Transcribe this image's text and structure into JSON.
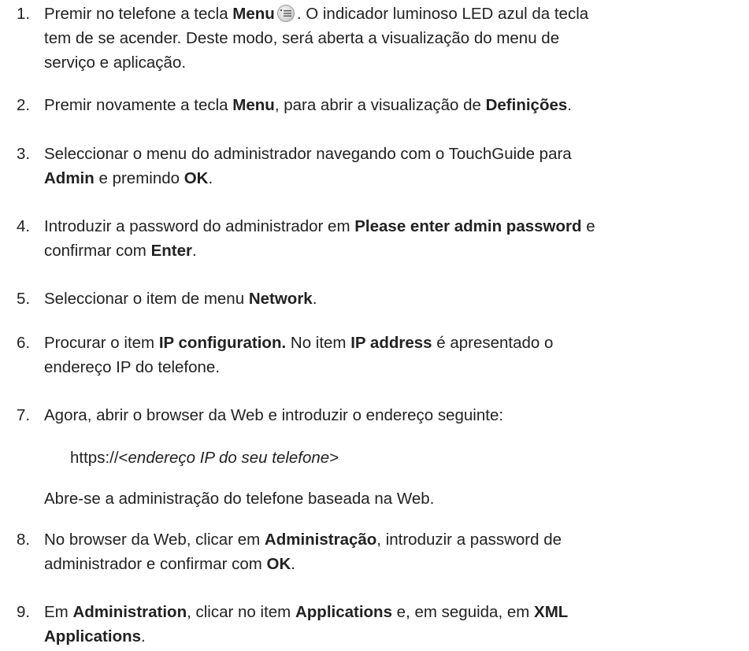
{
  "steps": [
    {
      "number": "1.",
      "lines": [
        {
          "t1": "Premir no telefone a tecla ",
          "b1": "Menu",
          "t2": ". O indicador luminoso LED azul da tecla"
        },
        {
          "t1": "tem de se acender. Deste modo, será aberta a visualização do menu de"
        },
        {
          "t1": "serviço e aplicação."
        }
      ]
    },
    {
      "number": "2.",
      "lines": [
        {
          "t1": "Premir novamente a tecla ",
          "b1": "Menu",
          "t2": ", para abrir a visualização de ",
          "b2": "Definições",
          "t3": "."
        }
      ]
    },
    {
      "number": "3.",
      "lines": [
        {
          "t1": "Seleccionar o menu do administrador navegando com o TouchGuide para"
        },
        {
          "b1": "Admin",
          "t2": " e premindo ",
          "b2": "OK",
          "t3": "."
        }
      ]
    },
    {
      "number": "4.",
      "lines": [
        {
          "t1": "Introduzir a password do administrador em ",
          "b1": "Please enter admin password",
          "t2": " e"
        },
        {
          "t1": "confirmar com ",
          "b1": "Enter",
          "t2": "."
        }
      ]
    },
    {
      "number": "5.",
      "lines": [
        {
          "t1": "Seleccionar o item de menu ",
          "b1": "Network",
          "t2": "."
        }
      ]
    },
    {
      "number": "6.",
      "lines": [
        {
          "t1": "Procurar o item ",
          "b1": "IP configuration.",
          "t2": " No item ",
          "b2": "IP address",
          "t3": " é apresentado o"
        },
        {
          "t1": "endereço IP do telefone."
        }
      ]
    },
    {
      "number": "7.",
      "lines": [
        {
          "t1": "Agora, abrir o browser da Web e introduzir o endereço seguinte:"
        }
      ]
    },
    {
      "number": "8.",
      "lines": [
        {
          "t1": "No browser da Web, clicar em ",
          "b1": "Administração",
          "t2": ", introduzir a password de"
        },
        {
          "t1": "administrador e confirmar com ",
          "b1": "OK",
          "t2": "."
        }
      ]
    },
    {
      "number": "9.",
      "lines": [
        {
          "t1": "Em ",
          "b1": "Administration",
          "t2": ", clicar no item ",
          "b2": "Applications",
          "t3": " e, em seguida, em ",
          "b3": "XML"
        },
        {
          "b1": "Applications",
          "t2": "."
        }
      ]
    }
  ],
  "url_example": {
    "prefix": "https://<",
    "italic": "endereço IP do seu telefone",
    "suffix": ">"
  },
  "note_after_step7": "Abre-se a administração do telefone baseada na Web.",
  "icons": {
    "menu_key": "menu-key-icon"
  }
}
